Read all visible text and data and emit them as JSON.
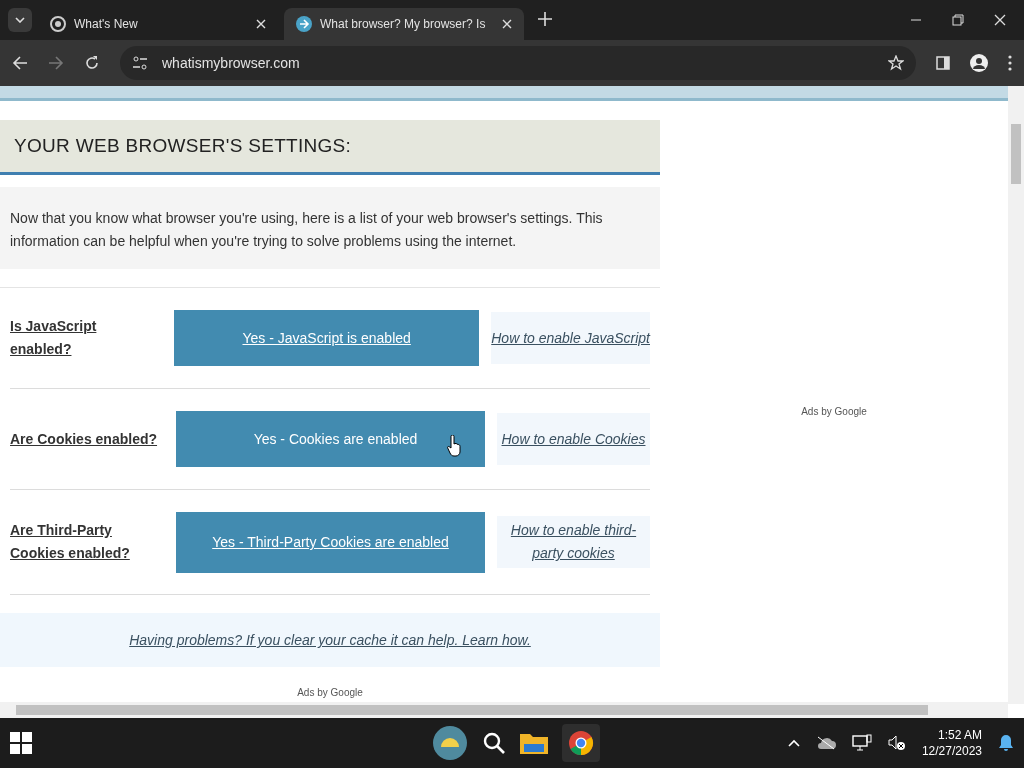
{
  "tabs": [
    {
      "title": "What's New",
      "selected": false
    },
    {
      "title": "What browser? My browser? Is",
      "selected": true
    }
  ],
  "address": "whatismybrowser.com",
  "page": {
    "heading": "YOUR WEB BROWSER'S SETTINGS:",
    "intro": "Now that you know what browser you're using, here is a list of your web browser's settings. This information can be helpful when you're trying to solve problems using the internet.",
    "settings": [
      {
        "question": "Is JavaScript enabled?",
        "answer": "Yes - JavaScript is enabled",
        "help": "How to enable JavaScript",
        "hovered": false
      },
      {
        "question": "Are Cookies enabled?",
        "answer": "Yes - Cookies are enabled",
        "help": "How to enable Cookies",
        "hovered": true
      },
      {
        "question": "Are Third-Party Cookies enabled?",
        "answer": "Yes - Third-Party Cookies are enabled",
        "help": "How to enable third-party cookies",
        "hovered": false
      }
    ],
    "problems_link": "Having problems? If you clear your cache it can help. Learn how.",
    "ads_label_main": "Ads by Google",
    "ads_label_side": "Ads by Google"
  },
  "taskbar": {
    "time": "1:52 AM",
    "date": "12/27/2023"
  }
}
